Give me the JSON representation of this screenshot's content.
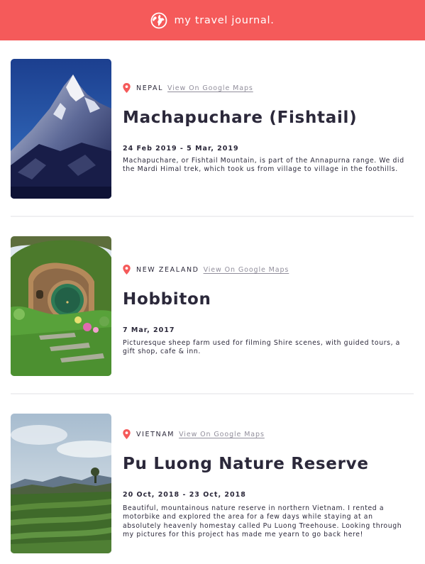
{
  "header": {
    "title": "my travel journal.",
    "icon": "globe-icon",
    "background": "#f55a5a"
  },
  "entries": [
    {
      "country": "NEPAL",
      "maps_link": "View On Google Maps",
      "title": "Machapuchare (Fishtail)",
      "dates": "24 Feb 2019 - 5 Mar, 2019",
      "description": "Machapuchare, or Fishtail Mountain, is part of the Annapurna range. We did the Mardi Himal trek, which took us from village to village in the foothills.",
      "image": "mountain-photo"
    },
    {
      "country": "NEW ZEALAND",
      "maps_link": "View On Google Maps",
      "title": "Hobbiton",
      "dates": "7 Mar, 2017",
      "description": "Picturesque sheep farm used for filming Shire scenes, with guided tours, a gift shop, cafe & inn.",
      "image": "hobbit-hole-photo"
    },
    {
      "country": "VIETNAM",
      "maps_link": "View On Google Maps",
      "title": "Pu Luong Nature Reserve",
      "dates": "20 Oct, 2018 - 23 Oct, 2018",
      "description": "Beautiful, mountainous nature reserve in northern Vietnam. I rented a motorbike and explored the area for a few days while staying at an absolutely heavenly homestay called Pu Luong Treehouse. Looking through my pictures for this project has made me yearn to go back here!",
      "image": "rice-terrace-photo"
    }
  ],
  "colors": {
    "accent": "#f55a5a",
    "text": "#2b283a",
    "muted": "#918e9b",
    "divider": "#f0f0f2"
  }
}
